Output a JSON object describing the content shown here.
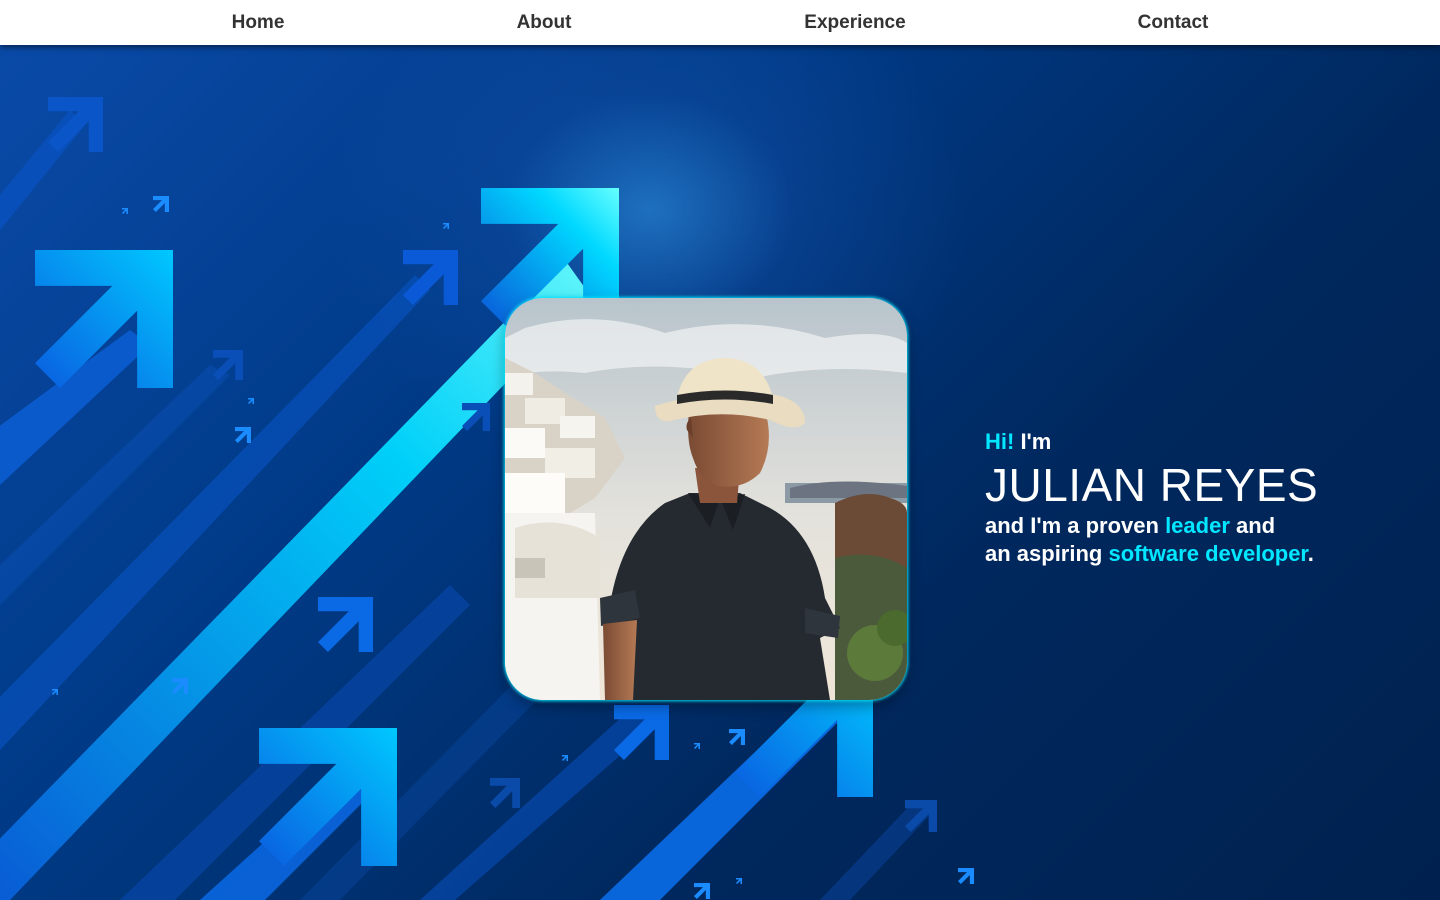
{
  "nav": {
    "home": "Home",
    "about": "About",
    "experience": "Experience",
    "contact": "Contact"
  },
  "hero": {
    "greeting_hi": "Hi!",
    "greeting_im": " I'm",
    "name": "JULIAN REYES",
    "line1_prefix": "and I'm a proven ",
    "line1_highlight": "leader",
    "line1_suffix": " and",
    "line2_prefix": "an aspiring ",
    "line2_highlight": "software developer",
    "line2_suffix": "."
  },
  "colors": {
    "accent": "#00e7ff",
    "background": "#002a5c",
    "navbar": "#ffffff",
    "nav_text": "#333333"
  },
  "icons": [
    "arrow-up-right-icon"
  ]
}
